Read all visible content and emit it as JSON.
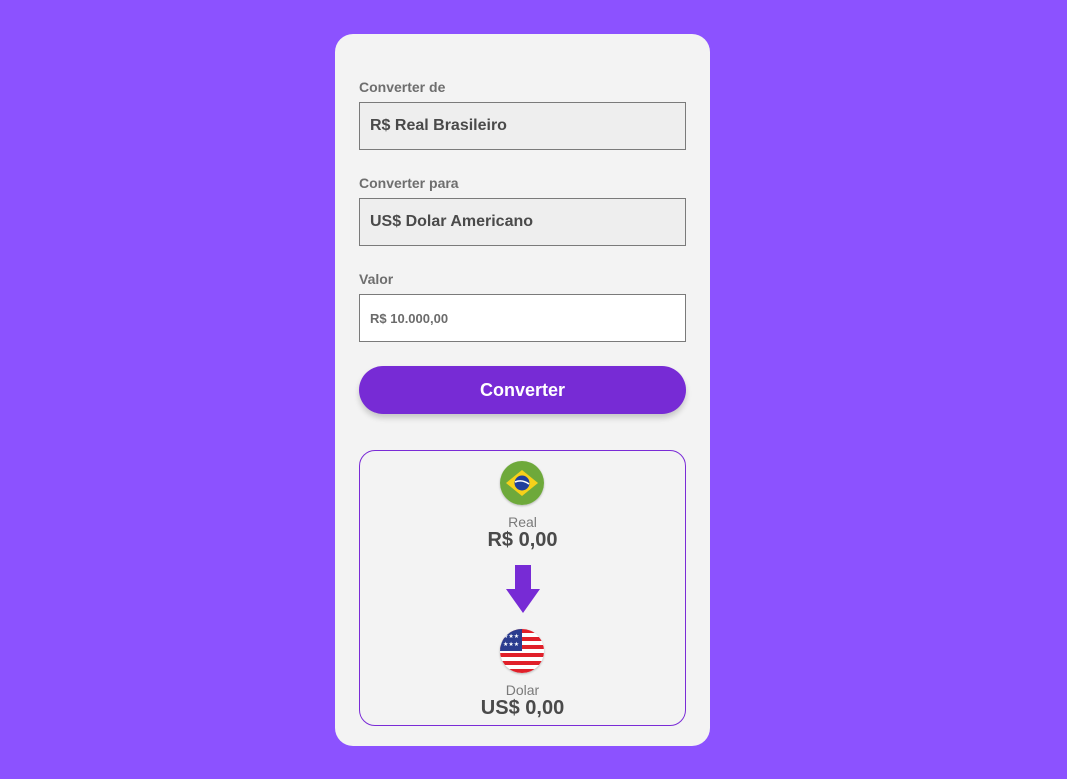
{
  "form": {
    "from_label": "Converter de",
    "from_value": "R$ Real Brasileiro",
    "to_label": "Converter para",
    "to_value": "US$ Dolar Americano",
    "amount_label": "Valor",
    "amount_placeholder": "R$ 10.000,00",
    "convert_button": "Converter"
  },
  "result": {
    "from_currency_name": "Real",
    "from_currency_value": "R$ 0,00",
    "from_flag_icon": "brazil-flag-icon",
    "to_currency_name": "Dolar",
    "to_currency_value": "US$ 0,00",
    "to_flag_icon": "usa-flag-icon",
    "arrow_icon": "arrow-down-icon"
  },
  "colors": {
    "background": "#8c52ff",
    "card": "#f3f3f3",
    "accent": "#772bd5"
  }
}
